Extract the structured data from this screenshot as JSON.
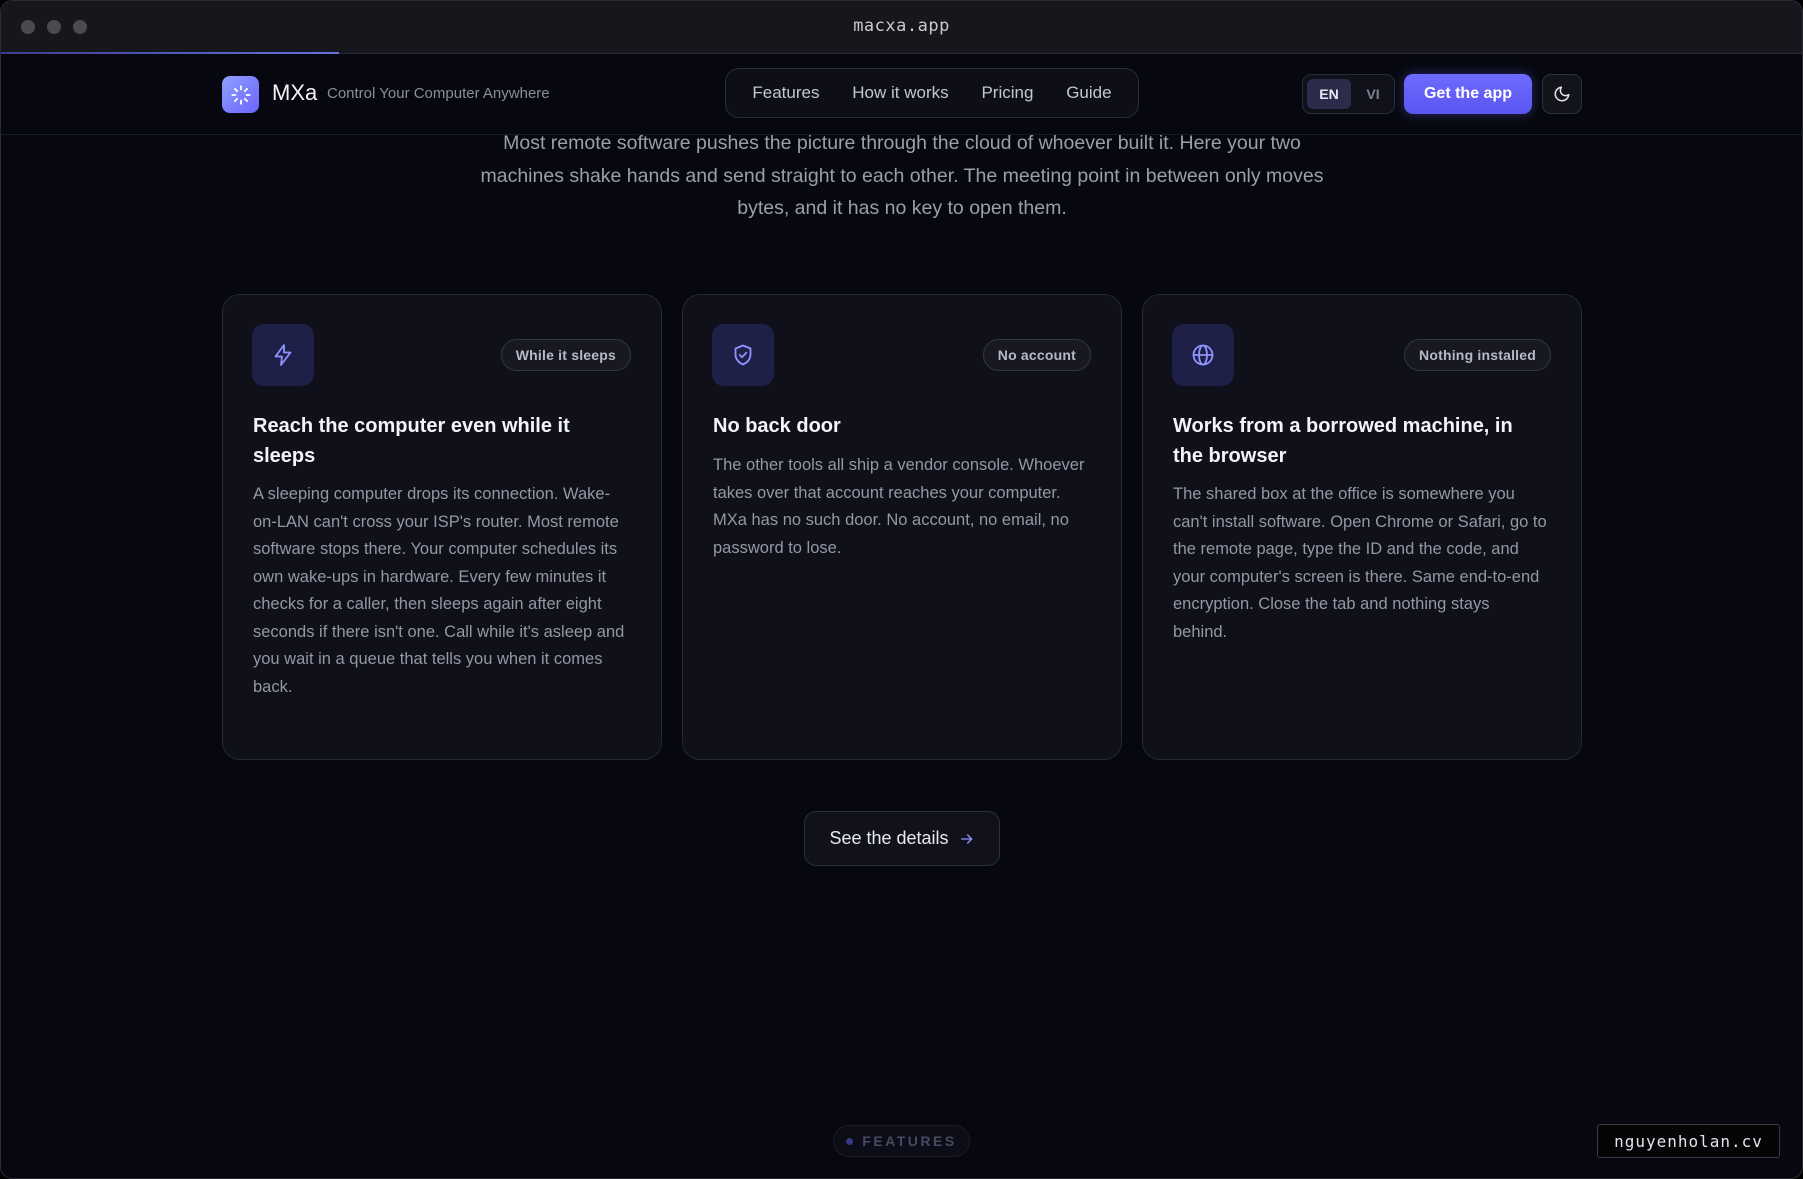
{
  "window": {
    "title": "macxa.app"
  },
  "nav": {
    "brand": "MXa",
    "tagline": "Control Your Computer Anywhere",
    "links": [
      "Features",
      "How it works",
      "Pricing",
      "Guide"
    ],
    "lang_en": "EN",
    "lang_vi": "VI",
    "cta": "Get the app"
  },
  "intro": "Most remote software pushes the picture through the cloud of whoever built it. Here your two machines shake hands and send straight to each other. The meeting point in between only moves bytes, and it has no key to open them.",
  "cards": [
    {
      "icon": "lightning-icon",
      "badge": "While it sleeps",
      "title": "Reach the computer even while it sleeps",
      "body": "A sleeping computer drops its connection. Wake-on-LAN can't cross your ISP's router. Most remote software stops there. Your computer schedules its own wake-ups in hardware. Every few minutes it checks for a caller, then sleeps again after eight seconds if there isn't one. Call while it's asleep and you wait in a queue that tells you when it comes back."
    },
    {
      "icon": "shield-check-icon",
      "badge": "No account",
      "title": "No back door",
      "body": "The other tools all ship a vendor console. Whoever takes over that account reaches your computer. MXa has no such door. No account, no email, no password to lose."
    },
    {
      "icon": "globe-icon",
      "badge": "Nothing installed",
      "title": "Works from a borrowed machine, in the browser",
      "body": "The shared box at the office is somewhere you can't install software. Open Chrome or Safari, go to the remote page, type the ID and the code, and your computer's screen is there. Same end-to-end encryption. Close the tab and nothing stays behind."
    }
  ],
  "details_button": "See the details",
  "section_label": "FEATURES",
  "watermark": "nguyenholan.cv",
  "colors": {
    "accent": "#6e6bff",
    "background": "#07080f",
    "card": "#0f1019",
    "icon_tile": "#1e2048"
  }
}
